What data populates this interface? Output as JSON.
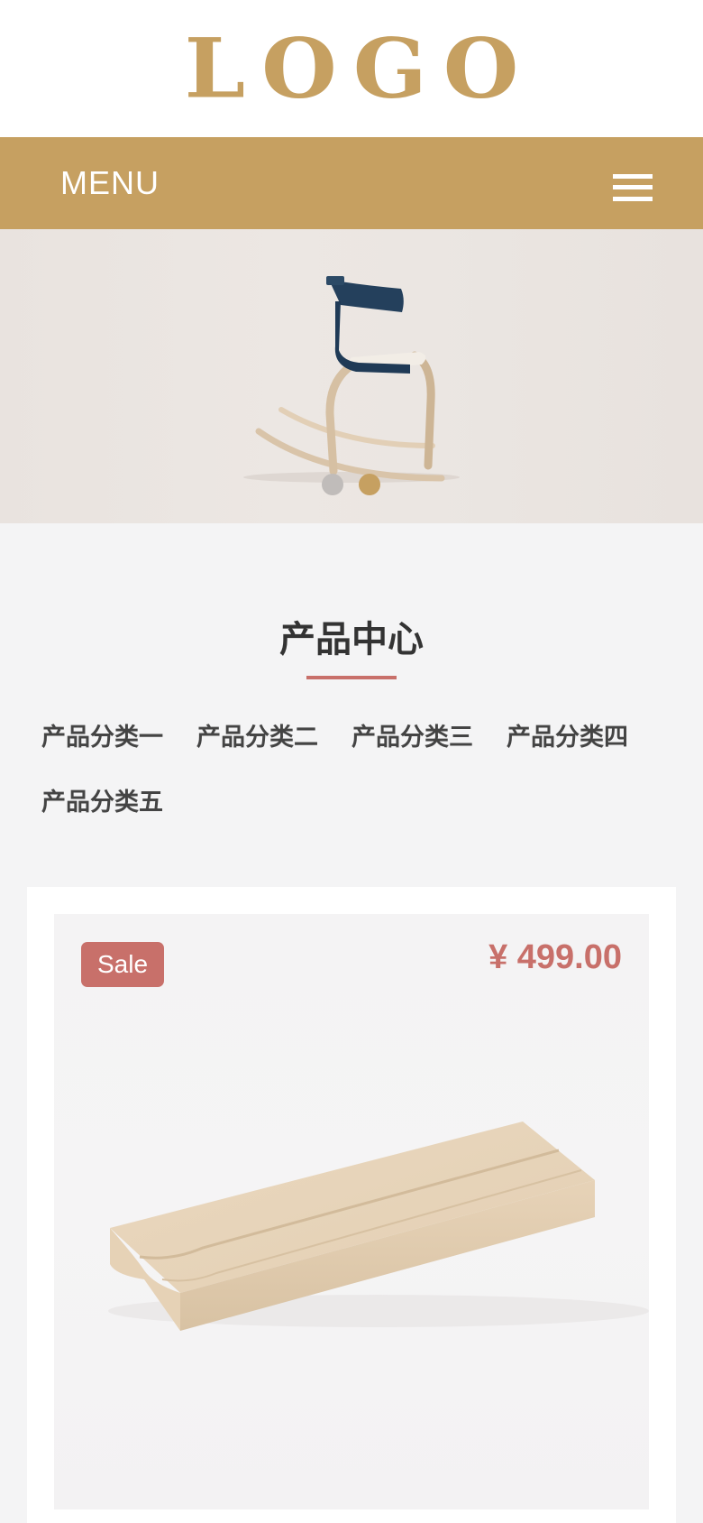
{
  "header": {
    "logo_text": "LOGO"
  },
  "nav": {
    "menu_label": "MENU",
    "menu_icon": "hamburger-menu-icon"
  },
  "banner": {
    "slide_count": 2,
    "active_slide": 2
  },
  "products": {
    "title": "产品中心",
    "categories": [
      "产品分类一",
      "产品分类二",
      "产品分类三",
      "产品分类四",
      "产品分类五"
    ],
    "items": [
      {
        "badge": "Sale",
        "price": "¥ 499.00"
      }
    ]
  },
  "colors": {
    "brand_gold": "#c6a061",
    "accent_red": "#c8706a",
    "text_dark": "#333333",
    "dot_inactive": "#c0bcba"
  }
}
